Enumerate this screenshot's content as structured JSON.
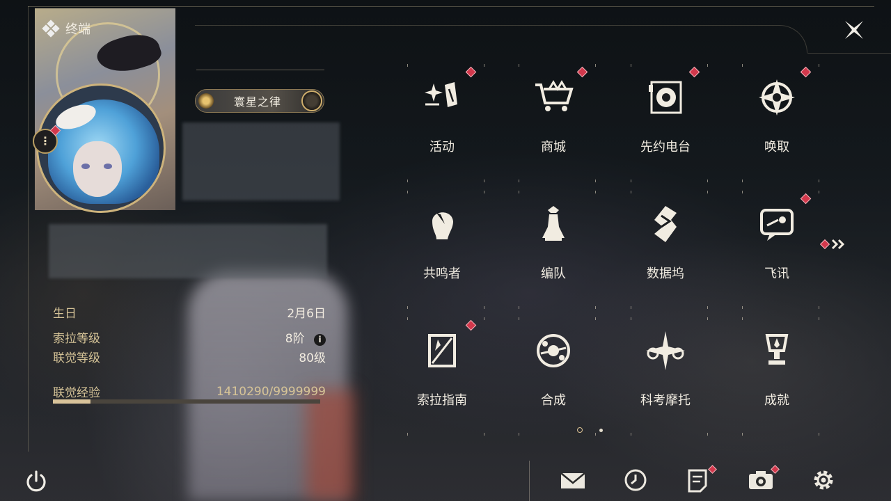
{
  "header": {
    "title": "终端",
    "close_icon": "close-x-icon"
  },
  "profile": {
    "title_badge": "寰星之律",
    "more_button_icon": "vertical-dots-icon"
  },
  "stats": {
    "birthday": {
      "label": "生日",
      "value": "2月6日"
    },
    "sola_level": {
      "label": "索拉等级",
      "value": "8阶"
    },
    "union_level": {
      "label": "联觉等级",
      "value": "80级"
    },
    "union_exp": {
      "label": "联觉经验",
      "value": "1410290/9999999",
      "progress": 0.141
    }
  },
  "grid": {
    "items": [
      {
        "label": "活动",
        "icon": "activity-sparkle-icon",
        "badge": true
      },
      {
        "label": "商城",
        "icon": "shop-cart-icon",
        "badge": true
      },
      {
        "label": "先约电台",
        "icon": "radio-record-icon",
        "badge": true
      },
      {
        "label": "唤取",
        "icon": "summon-compass-icon",
        "badge": true
      },
      {
        "label": "共鸣者",
        "icon": "resonator-head-icon",
        "badge": false
      },
      {
        "label": "编队",
        "icon": "team-chess-icon",
        "badge": false
      },
      {
        "label": "数据坞",
        "icon": "data-bank-icon",
        "badge": false
      },
      {
        "label": "飞讯",
        "icon": "message-chat-icon",
        "badge": true
      },
      {
        "label": "索拉指南",
        "icon": "guide-book-icon",
        "badge": true
      },
      {
        "label": "合成",
        "icon": "synthesis-orb-icon",
        "badge": false
      },
      {
        "label": "科考摩托",
        "icon": "motorbike-icon",
        "badge": false
      },
      {
        "label": "成就",
        "icon": "trophy-icon",
        "badge": false
      }
    ],
    "pagination": {
      "current": 1,
      "total": 2
    },
    "next_icon": "double-chevron-right-icon",
    "next_badge": true
  },
  "bottom_bar": {
    "power_icon": "power-icon",
    "buttons": [
      {
        "icon": "mail-icon",
        "badge": false
      },
      {
        "icon": "clock-icon",
        "badge": false
      },
      {
        "icon": "notice-icon",
        "badge": true
      },
      {
        "icon": "camera-icon",
        "badge": true
      },
      {
        "icon": "settings-gear-icon",
        "badge": false
      }
    ]
  },
  "colors": {
    "accent_gold": "#cdb37c",
    "badge_red": "#d2384c",
    "text": "#f1ece1"
  }
}
